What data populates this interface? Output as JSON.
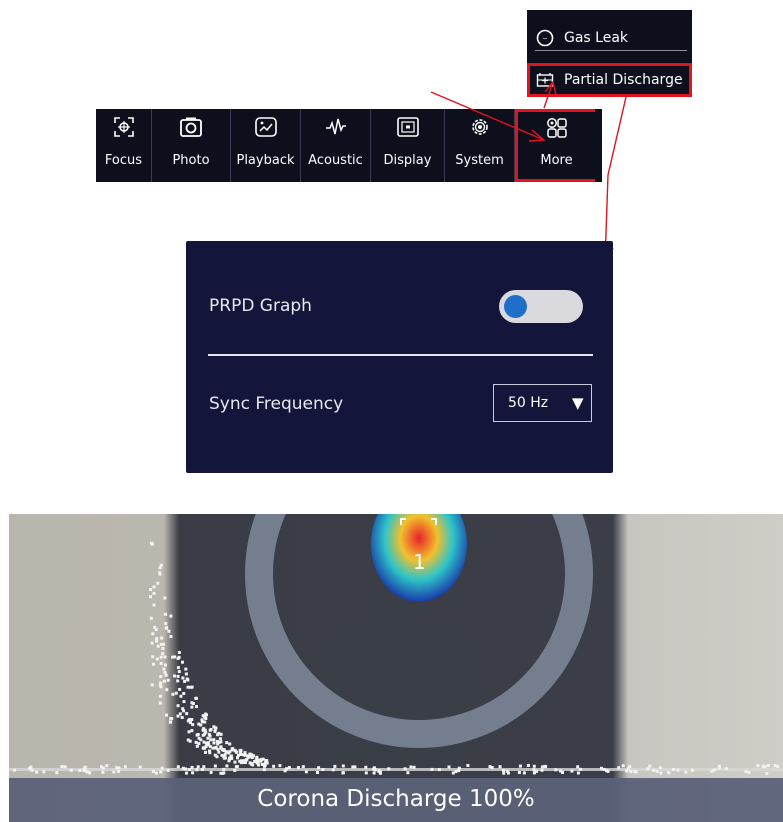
{
  "toolbar": {
    "items": [
      {
        "label": "Focus",
        "icon": "focus-icon"
      },
      {
        "label": "Photo",
        "icon": "camera-icon"
      },
      {
        "label": "Playback",
        "icon": "playback-icon"
      },
      {
        "label": "Acoustic",
        "icon": "waveform-icon"
      },
      {
        "label": "Display",
        "icon": "display-icon"
      },
      {
        "label": "System",
        "icon": "gear-icon"
      },
      {
        "label": "More",
        "icon": "grid-icon"
      }
    ]
  },
  "dropdown": {
    "items": [
      {
        "label": "Gas Leak",
        "icon": "gas-leak-icon"
      },
      {
        "label": "Partial Discharge",
        "icon": "battery-icon"
      }
    ]
  },
  "settings": {
    "prpd_label": "PRPD Graph",
    "prpd_enabled": false,
    "sync_label": "Sync Frequency",
    "sync_value": "50 Hz",
    "sync_arrow": "▼"
  },
  "camera": {
    "target_number": "1",
    "caption": "Corona Discharge 100%"
  },
  "colors": {
    "highlight": "#e0131e",
    "toolbar_bg": "#0d0f1d",
    "panel_bg": "#13163a",
    "toggle_knob": "#1f6fc9"
  }
}
